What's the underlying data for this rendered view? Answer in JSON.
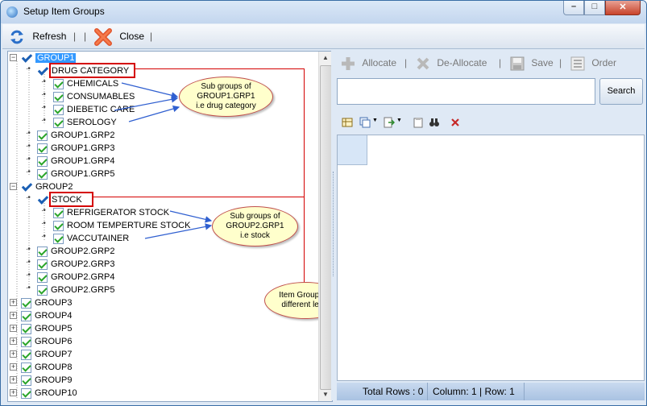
{
  "window": {
    "title": "Setup Item Groups",
    "controls": {
      "minimize": "–",
      "maximize": "□",
      "close": "✕"
    }
  },
  "toolbar": {
    "refresh_label": "Refresh",
    "separator": "|",
    "close_label": "Close"
  },
  "tree": {
    "group1": "GROUP1",
    "drug_category": "DRUG CATEGORY",
    "chemicals": "CHEMICALS",
    "consumables": "CONSUMABLES",
    "diebetic_care": "DIEBETIC CARE",
    "serology": "SEROLOGY",
    "g1grp2": "GROUP1.GRP2",
    "g1grp3": "GROUP1.GRP3",
    "g1grp4": "GROUP1.GRP4",
    "g1grp5": "GROUP1.GRP5",
    "group2": "GROUP2",
    "stock": "STOCK",
    "refrigerator_stock": "REFRIGERATOR STOCK",
    "room_temperture_stock": "ROOM TEMPERTURE STOCK",
    "vaccutainer": "VACCUTAINER",
    "g2grp2": "GROUP2.GRP2",
    "g2grp3": "GROUP2.GRP3",
    "g2grp4": "GROUP2.GRP4",
    "g2grp5": "GROUP2.GRP5",
    "group3": "GROUP3",
    "group4": "GROUP4",
    "group5": "GROUP5",
    "group6": "GROUP6",
    "group7": "GROUP7",
    "group8": "GROUP8",
    "group9": "GROUP9",
    "group10": "GROUP10"
  },
  "callouts": {
    "c1": [
      "Sub groups of",
      "GROUP1.GRP1",
      "i.e drug category"
    ],
    "c2": [
      "Sub groups of",
      "GROUP2.GRP1",
      "i.e stock"
    ],
    "c3": [
      "Item Groups in",
      "different level"
    ]
  },
  "actions": {
    "allocate_label": "Allocate",
    "deallocate_label": "De-Allocate",
    "save_label": "Save",
    "order_label": "Order",
    "separator": "|",
    "search_label": "Search"
  },
  "status": {
    "total_rows": "Total Rows : 0",
    "column_row": "Column: 1 | Row: 1"
  },
  "colors": {
    "accent": "#3399ff",
    "annotation": "#d40000",
    "callout_fill": "#ffffcc"
  }
}
